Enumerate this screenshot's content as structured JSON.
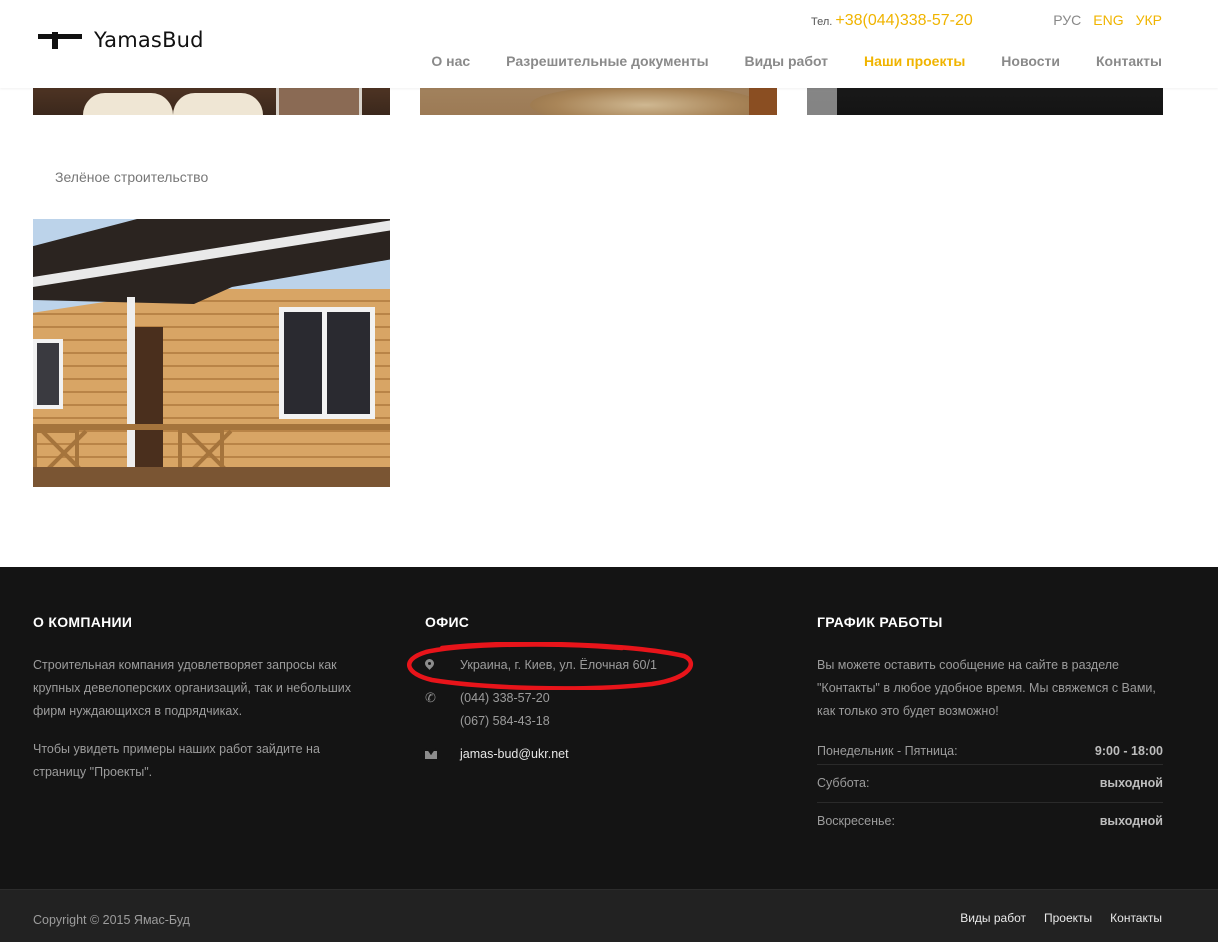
{
  "header": {
    "logo_text": "YamasBud",
    "phone_label": "Тел.",
    "phone": "+38(044)338-57-20",
    "langs": [
      "РУС",
      "ENG",
      "УКР"
    ],
    "nav": [
      "О нас",
      "Разрешительные документы",
      "Виды работ",
      "Наши проекты",
      "Новости",
      "Контакты"
    ]
  },
  "gallery": {
    "category": "Зелёное строительство"
  },
  "footer": {
    "about": {
      "title": "О КОМПАНИИ",
      "p1": "Строительная компания удовлетворяет запросы как крупных девелоперских организаций, так и небольших фирм нуждающихся в подрядчиках.",
      "p2": "Чтобы увидеть примеры наших работ зайдите на страницу \"Проекты\"."
    },
    "office": {
      "title": "ОФИС",
      "address": "Украина, г. Киев, ул. Ёлочная 60/1",
      "phone1": "(044) 338-57-20",
      "phone2": "(067) 584-43-18",
      "email": "jamas-bud@ukr.net"
    },
    "schedule": {
      "title": "ГРАФИК РАБОТЫ",
      "p1": "Вы можете оставить сообщение на сайте в разделе \"Контакты\" в любое удобное время. Мы свяжемся с Вами, как только это будет возможно!",
      "rows": [
        {
          "day": "Понедельник - Пятница:",
          "time": "9:00 - 18:00"
        },
        {
          "day": "Суббота:",
          "time": "выходной"
        },
        {
          "day": "Воскресенье:",
          "time": "выходной"
        }
      ]
    },
    "copyright": "Copyright © 2015 Ямас-Буд",
    "bottom_nav": [
      "Виды работ",
      "Проекты",
      "Контакты"
    ]
  },
  "colors": {
    "accent": "#f0b400",
    "footer_bg": "#141414",
    "annotation": "#e8141a"
  }
}
